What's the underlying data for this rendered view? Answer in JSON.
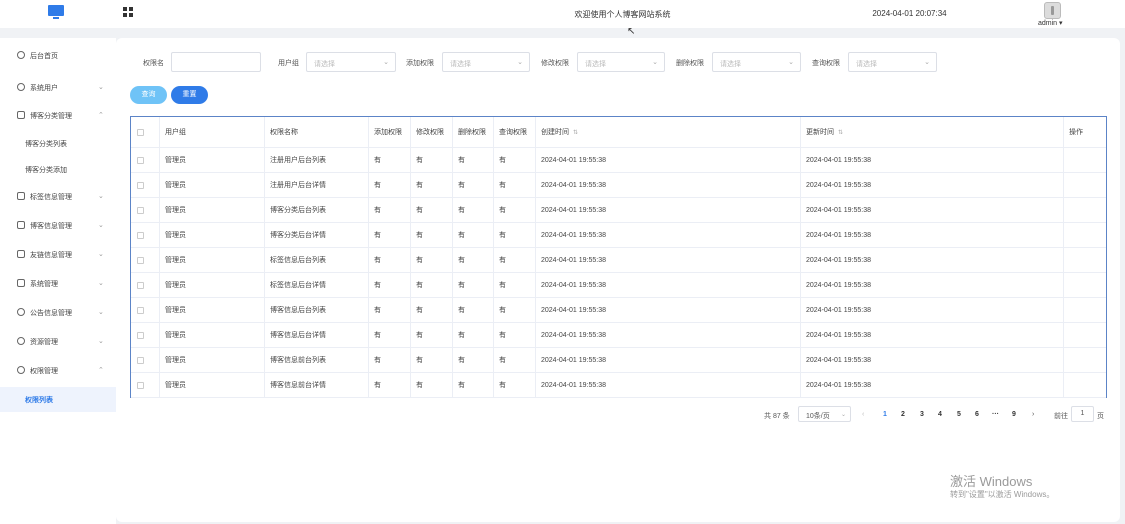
{
  "header": {
    "title": "欢迎使用个人博客网站系统",
    "datetime": "2024-04-01 20:07:34",
    "user": "admin"
  },
  "sidebar": {
    "items": [
      {
        "label": "后台首页",
        "icon": "dashboard-icon",
        "chevron": ""
      },
      {
        "label": "系统用户",
        "icon": "user-icon",
        "chevron": "⌄"
      },
      {
        "label": "博客分类管理",
        "icon": "category-icon",
        "chevron": "⌃"
      },
      {
        "label": "标签信息管理",
        "icon": "tag-icon",
        "chevron": "⌄"
      },
      {
        "label": "博客信息管理",
        "icon": "blog-icon",
        "chevron": "⌄"
      },
      {
        "label": "友链信息管理",
        "icon": "link-icon",
        "chevron": "⌄"
      },
      {
        "label": "系统管理",
        "icon": "settings-icon",
        "chevron": "⌄"
      },
      {
        "label": "公告信息管理",
        "icon": "notice-icon",
        "chevron": "⌄"
      },
      {
        "label": "资源管理",
        "icon": "resource-icon",
        "chevron": "⌄"
      },
      {
        "label": "权限管理",
        "icon": "permission-icon",
        "chevron": "⌃"
      }
    ],
    "subitems": {
      "category_list": "博客分类列表",
      "category_add": "博客分类添加",
      "permission_list": "权限列表"
    }
  },
  "filters": {
    "perm_name_label": "权限名",
    "perm_name_value": "",
    "user_group_label": "用户组",
    "add_perm_label": "添加权限",
    "edit_perm_label": "修改权限",
    "delete_perm_label": "删除权限",
    "query_perm_label": "查询权限",
    "placeholder": "请选择"
  },
  "buttons": {
    "query": "查询",
    "reset": "重置"
  },
  "table": {
    "columns": [
      "用户组",
      "权限名称",
      "添加权限",
      "修改权限",
      "删除权限",
      "查询权限",
      "创建时间",
      "更新时间",
      "操作"
    ],
    "rows": [
      [
        "管理员",
        "注册用户后台列表",
        "有",
        "有",
        "有",
        "有",
        "2024-04-01 19:55:38",
        "2024-04-01 19:55:38",
        ""
      ],
      [
        "管理员",
        "注册用户后台详情",
        "有",
        "有",
        "有",
        "有",
        "2024-04-01 19:55:38",
        "2024-04-01 19:55:38",
        ""
      ],
      [
        "管理员",
        "博客分类后台列表",
        "有",
        "有",
        "有",
        "有",
        "2024-04-01 19:55:38",
        "2024-04-01 19:55:38",
        ""
      ],
      [
        "管理员",
        "博客分类后台详情",
        "有",
        "有",
        "有",
        "有",
        "2024-04-01 19:55:38",
        "2024-04-01 19:55:38",
        ""
      ],
      [
        "管理员",
        "标签信息后台列表",
        "有",
        "有",
        "有",
        "有",
        "2024-04-01 19:55:38",
        "2024-04-01 19:55:38",
        ""
      ],
      [
        "管理员",
        "标签信息后台详情",
        "有",
        "有",
        "有",
        "有",
        "2024-04-01 19:55:38",
        "2024-04-01 19:55:38",
        ""
      ],
      [
        "管理员",
        "博客信息后台列表",
        "有",
        "有",
        "有",
        "有",
        "2024-04-01 19:55:38",
        "2024-04-01 19:55:38",
        ""
      ],
      [
        "管理员",
        "博客信息后台详情",
        "有",
        "有",
        "有",
        "有",
        "2024-04-01 19:55:38",
        "2024-04-01 19:55:38",
        ""
      ],
      [
        "管理员",
        "博客信息前台列表",
        "有",
        "有",
        "有",
        "有",
        "2024-04-01 19:55:38",
        "2024-04-01 19:55:38",
        ""
      ],
      [
        "管理员",
        "博客信息前台详情",
        "有",
        "有",
        "有",
        "有",
        "2024-04-01 19:55:38",
        "2024-04-01 19:55:38",
        ""
      ]
    ]
  },
  "pagination": {
    "total": "共 87 条",
    "page_size": "10条/页",
    "pages": [
      "1",
      "2",
      "3",
      "4",
      "5",
      "6",
      "···",
      "9"
    ],
    "current": "1",
    "goto_label": "前往",
    "goto_value": "1",
    "page_unit": "页",
    "prev": "‹",
    "next": "›"
  },
  "watermark": {
    "line1": "激活 Windows",
    "line2": "转到\"设置\"以激活 Windows。"
  },
  "colors": {
    "primary": "#2f7be8",
    "query_button": "#6fc3f7",
    "table_border": "#5c84c7",
    "background": "#f0f2f5"
  }
}
